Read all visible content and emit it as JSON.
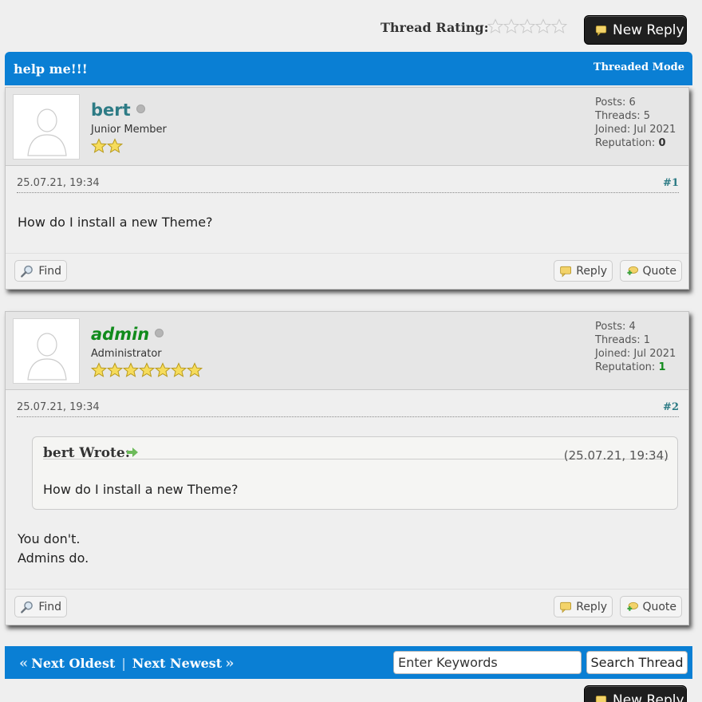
{
  "top": {
    "rating_label": "Thread Rating:",
    "rating_value": 0,
    "rating_max": 5,
    "new_reply_label": "New Reply"
  },
  "thread": {
    "title": "help me!!!",
    "mode_label": "Threaded Mode"
  },
  "posts": [
    {
      "username": "bert",
      "usertitle": "Junior Member",
      "stars": 2,
      "stats": {
        "posts": "Posts: 6",
        "threads": "Threads: 5",
        "joined": "Joined: Jul 2021",
        "rep_label": "Reputation:",
        "rep_value": "0"
      },
      "date": "25.07.21, 19:34",
      "number": "#1",
      "body_lines": [
        "How do I install a new Theme?"
      ],
      "controls": {
        "find": "Find",
        "reply": "Reply",
        "quote": "Quote"
      }
    },
    {
      "username": "admin",
      "usertitle": "Administrator",
      "stars": 7,
      "stats": {
        "posts": "Posts: 4",
        "threads": "Threads: 1",
        "joined": "Joined: Jul 2021",
        "rep_label": "Reputation:",
        "rep_value": "1"
      },
      "date": "25.07.21, 19:34",
      "number": "#2",
      "quote": {
        "author": "bert Wrote:",
        "time": "(25.07.21, 19:34)",
        "text": "How do I install a new Theme?"
      },
      "body_lines": [
        "You don't.",
        "Admins do."
      ],
      "controls": {
        "find": "Find",
        "reply": "Reply",
        "quote": "Quote"
      }
    }
  ],
  "footer": {
    "next_oldest": "Next Oldest",
    "separator": "|",
    "next_newest": "Next Newest",
    "search_placeholder": "Enter Keywords",
    "search_button": "Search Thread"
  },
  "colors": {
    "accent": "#0a7fd4",
    "username_member": "#2d7b85",
    "username_admin": "#118b1c"
  }
}
